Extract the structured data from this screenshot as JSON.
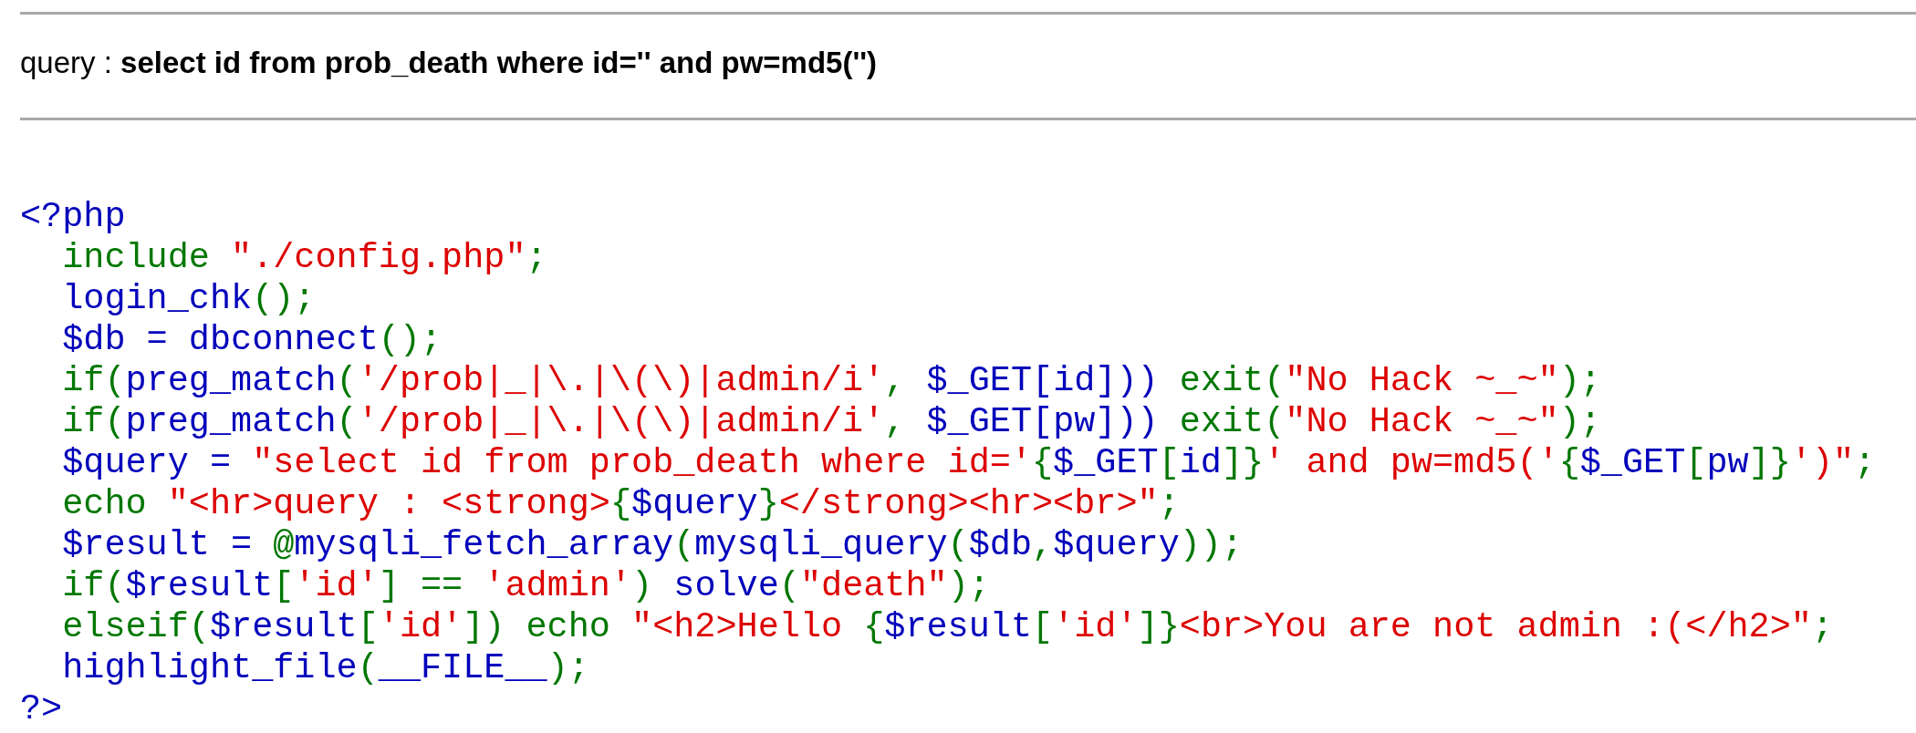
{
  "query_line": "query : **select id from prob_death where id='' and pw=md5('')**",
  "source_code": [
    [
      {
        "kind": "default",
        "text": "<?php"
      }
    ],
    [
      {
        "kind": "keyword",
        "text": "  include "
      },
      {
        "kind": "string",
        "text": "\"./config.php\""
      },
      {
        "kind": "keyword",
        "text": ";"
      }
    ],
    [
      {
        "kind": "default",
        "text": "  login_chk"
      },
      {
        "kind": "keyword",
        "text": "();"
      }
    ],
    [
      {
        "kind": "default",
        "text": "  $db = dbconnect"
      },
      {
        "kind": "keyword",
        "text": "();"
      }
    ],
    [
      {
        "kind": "keyword",
        "text": "  if("
      },
      {
        "kind": "default",
        "text": "preg_match"
      },
      {
        "kind": "keyword",
        "text": "("
      },
      {
        "kind": "string",
        "text": "'/prob|_|\\.|\\(\\)|admin/i'"
      },
      {
        "kind": "keyword",
        "text": ", "
      },
      {
        "kind": "default",
        "text": "$_GET[id]))"
      },
      {
        "kind": "keyword",
        "text": " exit("
      },
      {
        "kind": "string",
        "text": "\"No Hack ~_~\""
      },
      {
        "kind": "keyword",
        "text": ");"
      }
    ],
    [
      {
        "kind": "keyword",
        "text": "  if("
      },
      {
        "kind": "default",
        "text": "preg_match"
      },
      {
        "kind": "keyword",
        "text": "("
      },
      {
        "kind": "string",
        "text": "'/prob|_|\\.|\\(\\)|admin/i'"
      },
      {
        "kind": "keyword",
        "text": ", "
      },
      {
        "kind": "default",
        "text": "$_GET[pw]))"
      },
      {
        "kind": "keyword",
        "text": " exit("
      },
      {
        "kind": "string",
        "text": "\"No Hack ~_~\""
      },
      {
        "kind": "keyword",
        "text": ");"
      }
    ],
    [
      {
        "kind": "default",
        "text": "  $query = "
      },
      {
        "kind": "string",
        "text": "\"select id from prob_death where id='"
      },
      {
        "kind": "keyword",
        "text": "{"
      },
      {
        "kind": "default",
        "text": "$_GET"
      },
      {
        "kind": "keyword",
        "text": "["
      },
      {
        "kind": "default",
        "text": "id"
      },
      {
        "kind": "keyword",
        "text": "]}"
      },
      {
        "kind": "string",
        "text": "' and pw=md5('"
      },
      {
        "kind": "keyword",
        "text": "{"
      },
      {
        "kind": "default",
        "text": "$_GET"
      },
      {
        "kind": "keyword",
        "text": "["
      },
      {
        "kind": "default",
        "text": "pw"
      },
      {
        "kind": "keyword",
        "text": "]}"
      },
      {
        "kind": "string",
        "text": "')\""
      },
      {
        "kind": "keyword",
        "text": ";"
      }
    ],
    [
      {
        "kind": "keyword",
        "text": "  echo "
      },
      {
        "kind": "string",
        "text": "\"<hr>query : <strong>"
      },
      {
        "kind": "keyword",
        "text": "{"
      },
      {
        "kind": "default",
        "text": "$query"
      },
      {
        "kind": "keyword",
        "text": "}"
      },
      {
        "kind": "string",
        "text": "</strong><hr><br>\""
      },
      {
        "kind": "keyword",
        "text": ";"
      }
    ],
    [
      {
        "kind": "default",
        "text": "  $result = "
      },
      {
        "kind": "keyword",
        "text": "@"
      },
      {
        "kind": "default",
        "text": "mysqli_fetch_array"
      },
      {
        "kind": "keyword",
        "text": "("
      },
      {
        "kind": "default",
        "text": "mysqli_query"
      },
      {
        "kind": "keyword",
        "text": "("
      },
      {
        "kind": "default",
        "text": "$db"
      },
      {
        "kind": "keyword",
        "text": ","
      },
      {
        "kind": "default",
        "text": "$query"
      },
      {
        "kind": "keyword",
        "text": "));"
      }
    ],
    [
      {
        "kind": "keyword",
        "text": "  if("
      },
      {
        "kind": "default",
        "text": "$result"
      },
      {
        "kind": "keyword",
        "text": "["
      },
      {
        "kind": "string",
        "text": "'id'"
      },
      {
        "kind": "keyword",
        "text": "] == "
      },
      {
        "kind": "string",
        "text": "'admin'"
      },
      {
        "kind": "keyword",
        "text": ") "
      },
      {
        "kind": "default",
        "text": "solve"
      },
      {
        "kind": "keyword",
        "text": "("
      },
      {
        "kind": "string",
        "text": "\"death\""
      },
      {
        "kind": "keyword",
        "text": ");"
      }
    ],
    [
      {
        "kind": "keyword",
        "text": "  elseif("
      },
      {
        "kind": "default",
        "text": "$result"
      },
      {
        "kind": "keyword",
        "text": "["
      },
      {
        "kind": "string",
        "text": "'id'"
      },
      {
        "kind": "keyword",
        "text": "]) echo "
      },
      {
        "kind": "string",
        "text": "\"<h2>Hello "
      },
      {
        "kind": "keyword",
        "text": "{"
      },
      {
        "kind": "default",
        "text": "$result"
      },
      {
        "kind": "keyword",
        "text": "["
      },
      {
        "kind": "string",
        "text": "'id'"
      },
      {
        "kind": "keyword",
        "text": "]}"
      },
      {
        "kind": "string",
        "text": "<br>You are not admin :(</h2>\""
      },
      {
        "kind": "keyword",
        "text": ";"
      }
    ],
    [
      {
        "kind": "default",
        "text": "  highlight_file"
      },
      {
        "kind": "keyword",
        "text": "("
      },
      {
        "kind": "default",
        "text": "__FILE__"
      },
      {
        "kind": "keyword",
        "text": ");"
      }
    ],
    [
      {
        "kind": "default",
        "text": "?>"
      }
    ]
  ]
}
